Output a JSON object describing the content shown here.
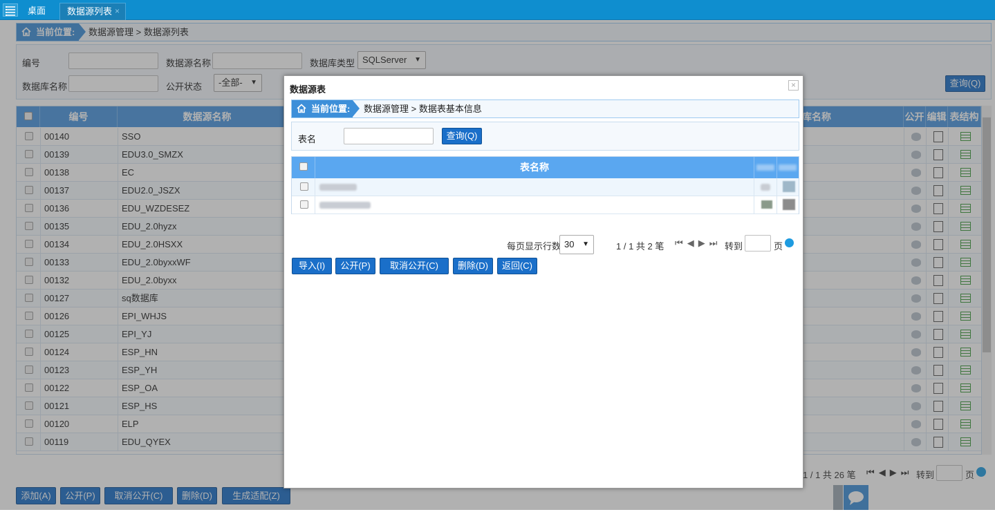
{
  "tabs": {
    "desktop": "桌面",
    "active": "数据源列表",
    "close": "×"
  },
  "breadcrumb": {
    "label": "当前位置:",
    "path": "数据源管理 > 数据源列表"
  },
  "filter": {
    "id_label": "编号",
    "name_label": "数据源名称",
    "dbtype_label": "数据库类型",
    "dbtype_value": "SQLServer",
    "dbname_label": "数据库名称",
    "status_label": "公开状态",
    "status_value": "-全部-",
    "query_button": "查询(Q)"
  },
  "grid": {
    "headers": {
      "id": "编号",
      "name": "数据源名称",
      "dbname": "库名称",
      "public": "公开",
      "edit": "编辑",
      "structure": "表结构"
    },
    "rows": [
      {
        "id": "00140",
        "name": "SSO"
      },
      {
        "id": "00139",
        "name": "EDU3.0_SMZX"
      },
      {
        "id": "00138",
        "name": "EC"
      },
      {
        "id": "00137",
        "name": "EDU2.0_JSZX"
      },
      {
        "id": "00136",
        "name": "EDU_WZDESEZ"
      },
      {
        "id": "00135",
        "name": "EDU_2.0hyzx"
      },
      {
        "id": "00134",
        "name": "EDU_2.0HSXX"
      },
      {
        "id": "00133",
        "name": "EDU_2.0byxxWF"
      },
      {
        "id": "00132",
        "name": "EDU_2.0byxx"
      },
      {
        "id": "00127",
        "name": "sq数据库"
      },
      {
        "id": "00126",
        "name": "EPI_WHJS"
      },
      {
        "id": "00125",
        "name": "EPI_YJ"
      },
      {
        "id": "00124",
        "name": "ESP_HN"
      },
      {
        "id": "00123",
        "name": "ESP_YH"
      },
      {
        "id": "00122",
        "name": "ESP_OA"
      },
      {
        "id": "00121",
        "name": "ESP_HS"
      },
      {
        "id": "00120",
        "name": "ELP"
      },
      {
        "id": "00119",
        "name": "EDU_QYEX"
      }
    ]
  },
  "bottom_pager": {
    "info": "1 / 1 共 26 笔",
    "goto": "转到",
    "page": "页"
  },
  "bottom_buttons": {
    "add": "添加(A)",
    "public": "公开(P)",
    "unpublic": "取消公开(C)",
    "delete": "删除(D)",
    "generate": "生成适配(Z)"
  },
  "modal": {
    "title": "数据源表",
    "breadcrumb_label": "当前位置:",
    "breadcrumb_path": "数据源管理 > 数据表基本信息",
    "table_name_label": "表名",
    "query_button": "查询(Q)",
    "header_name": "表名称",
    "pager": {
      "rows_label": "每页显示行数",
      "rows_value": "30",
      "info": "1 / 1 共 2 笔",
      "goto": "转到",
      "page": "页"
    },
    "buttons": {
      "import": "导入(I)",
      "public": "公开(P)",
      "unpublic": "取消公开(C)",
      "delete": "删除(D)",
      "back": "返回(C)"
    }
  },
  "colors": {
    "header_blue": "#4a97e0",
    "button_blue": "#1a6fc9",
    "topbar": "#0f8ecf"
  }
}
